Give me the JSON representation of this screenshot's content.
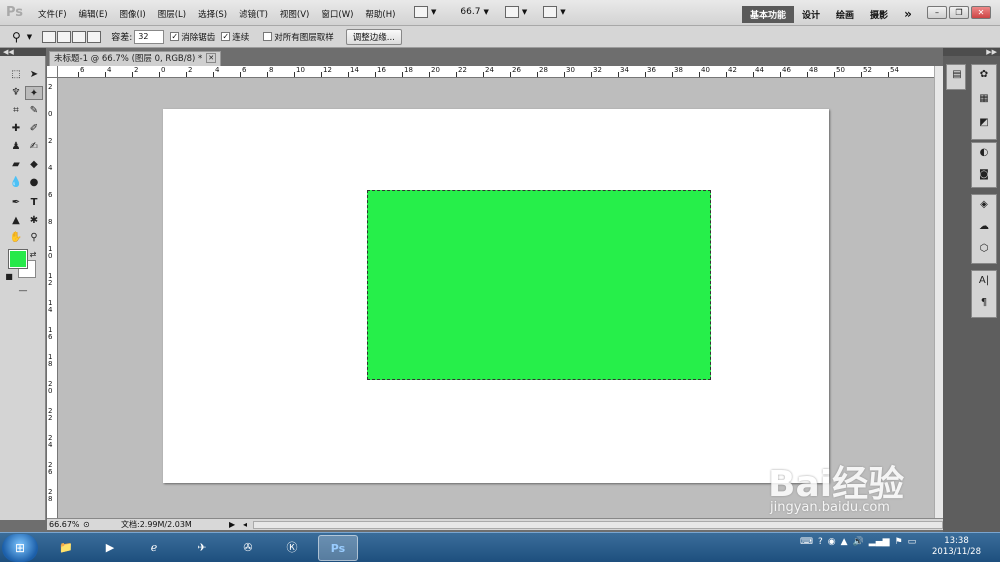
{
  "app": {
    "logo": "Ps"
  },
  "menu": [
    "文件(F)",
    "编辑(E)",
    "图像(I)",
    "图层(L)",
    "选择(S)",
    "滤镜(T)",
    "视图(V)",
    "窗口(W)",
    "帮助(H)"
  ],
  "menubar": {
    "zoom": "66.7"
  },
  "workspaces": [
    "基本功能",
    "设计",
    "绘画",
    "摄影"
  ],
  "workspace_more": "»",
  "options": {
    "tolerance_label": "容差:",
    "tolerance_value": "32",
    "antialias": "消除锯齿",
    "contiguous": "连续",
    "sample_all": "对所有图层取样",
    "refine_edge": "调整边缘..."
  },
  "document": {
    "tab_title": "未标题-1 @ 66.7% (图层 0, RGB/8) *",
    "fill_color": "#26ef4a"
  },
  "rulers": {
    "h": [
      "6",
      "4",
      "2",
      "0",
      "2",
      "4",
      "6",
      "8",
      "10",
      "12",
      "14",
      "16",
      "18",
      "20",
      "22",
      "24",
      "26",
      "28",
      "30",
      "32",
      "34",
      "36",
      "38",
      "40",
      "42",
      "44",
      "46",
      "48",
      "50",
      "52",
      "54"
    ],
    "v": [
      "2",
      "0",
      "2",
      "4",
      "6",
      "8",
      "1 0",
      "1 2",
      "1 4",
      "1 6",
      "1 8",
      "2 0",
      "2 2",
      "2 4",
      "2 6",
      "2 8"
    ]
  },
  "status": {
    "zoom": "66.67%",
    "doc_info": "文档:2.99M/2.03M"
  },
  "taskbar": {
    "time": "13:38",
    "date": "2013/11/28",
    "ps_label": "Ps"
  },
  "watermark": {
    "brand": "Bai经验",
    "url": "jingyan.baidu.com"
  }
}
